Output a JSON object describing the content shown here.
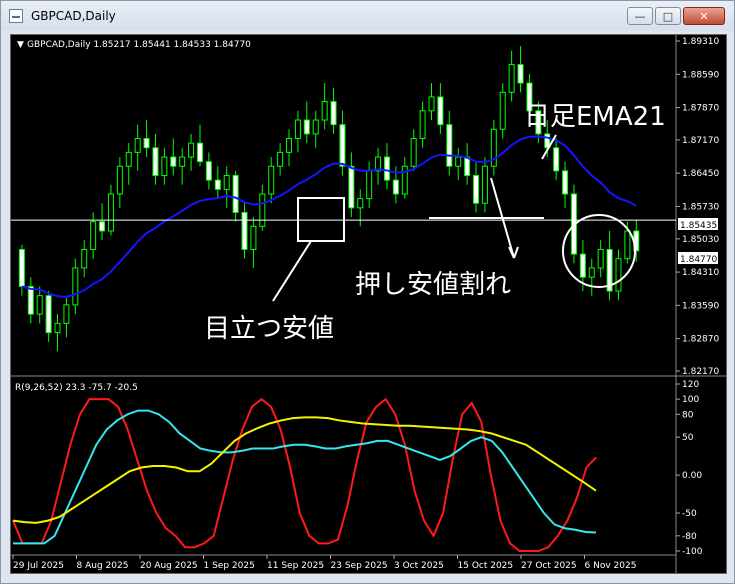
{
  "window": {
    "title": "GBPCAD,Daily"
  },
  "chart_header": "GBPCAD,Daily  1.85217 1.85441 1.84533 1.84770",
  "indicator_header": "R(9,26,52) 23.3 -75.7 -20.5",
  "annotations": {
    "ema_label": "日足EMA21",
    "notable_low": "目立つ安値",
    "break_label": "押し安値割れ"
  },
  "colors": {
    "bull": "#00ff00",
    "ema": "#1515ff",
    "r1": "#ff1a1a",
    "r2": "#35e6f0",
    "r3": "#f4f400",
    "annot": "#ffffff"
  },
  "chart_data": [
    {
      "type": "candlestick",
      "symbol": "GBPCAD",
      "timeframe": "Daily",
      "ohlc_last": [
        1.85217,
        1.85441,
        1.84533,
        1.8477
      ],
      "y_ticks": [
        "1.89310",
        "1.88590",
        "1.87870",
        "1.87170",
        "1.86450",
        "1.85730",
        "1.85030",
        "1.84310",
        "1.83590",
        "1.82870",
        "1.82170"
      ],
      "price_tags": [
        "1.85435",
        "1.84770"
      ],
      "horizontal_line": 1.85435,
      "ylim": [
        1.8217,
        1.8931
      ],
      "x_ticks": [
        "29 Jul 2025",
        "8 Aug 2025",
        "20 Aug 2025",
        "1 Sep 2025",
        "11 Sep 2025",
        "23 Sep 2025",
        "3 Oct 2025",
        "15 Oct 2025",
        "27 Oct 2025",
        "6 Nov 2025"
      ],
      "candles": [
        [
          1.848,
          1.849,
          1.838,
          1.84
        ],
        [
          1.84,
          1.842,
          1.832,
          1.834
        ],
        [
          1.834,
          1.84,
          1.832,
          1.838
        ],
        [
          1.838,
          1.839,
          1.828,
          1.83
        ],
        [
          1.83,
          1.834,
          1.826,
          1.832
        ],
        [
          1.832,
          1.838,
          1.829,
          1.836
        ],
        [
          1.836,
          1.846,
          1.834,
          1.844
        ],
        [
          1.844,
          1.85,
          1.842,
          1.848
        ],
        [
          1.848,
          1.856,
          1.846,
          1.854
        ],
        [
          1.854,
          1.858,
          1.85,
          1.852
        ],
        [
          1.852,
          1.862,
          1.851,
          1.86
        ],
        [
          1.86,
          1.868,
          1.857,
          1.866
        ],
        [
          1.866,
          1.871,
          1.862,
          1.869
        ],
        [
          1.869,
          1.875,
          1.865,
          1.872
        ],
        [
          1.872,
          1.876,
          1.868,
          1.87
        ],
        [
          1.87,
          1.873,
          1.862,
          1.864
        ],
        [
          1.864,
          1.87,
          1.862,
          1.868
        ],
        [
          1.868,
          1.872,
          1.864,
          1.866
        ],
        [
          1.866,
          1.87,
          1.862,
          1.868
        ],
        [
          1.868,
          1.873,
          1.865,
          1.871
        ],
        [
          1.871,
          1.875,
          1.866,
          1.867
        ],
        [
          1.867,
          1.869,
          1.861,
          1.863
        ],
        [
          1.863,
          1.866,
          1.859,
          1.861
        ],
        [
          1.861,
          1.866,
          1.857,
          1.864
        ],
        [
          1.864,
          1.865,
          1.854,
          1.856
        ],
        [
          1.856,
          1.858,
          1.846,
          1.848
        ],
        [
          1.848,
          1.855,
          1.844,
          1.853
        ],
        [
          1.853,
          1.862,
          1.852,
          1.86
        ],
        [
          1.86,
          1.868,
          1.858,
          1.866
        ],
        [
          1.866,
          1.871,
          1.864,
          1.869
        ],
        [
          1.869,
          1.874,
          1.866,
          1.872
        ],
        [
          1.872,
          1.878,
          1.869,
          1.876
        ],
        [
          1.876,
          1.88,
          1.871,
          1.873
        ],
        [
          1.873,
          1.878,
          1.87,
          1.876
        ],
        [
          1.876,
          1.884,
          1.874,
          1.88
        ],
        [
          1.88,
          1.883,
          1.873,
          1.875
        ],
        [
          1.875,
          1.878,
          1.864,
          1.866
        ],
        [
          1.866,
          1.869,
          1.855,
          1.857
        ],
        [
          1.857,
          1.861,
          1.853,
          1.859
        ],
        [
          1.859,
          1.867,
          1.857,
          1.865
        ],
        [
          1.865,
          1.87,
          1.862,
          1.868
        ],
        [
          1.868,
          1.871,
          1.861,
          1.863
        ],
        [
          1.863,
          1.866,
          1.858,
          1.86
        ],
        [
          1.86,
          1.868,
          1.859,
          1.866
        ],
        [
          1.866,
          1.874,
          1.865,
          1.872
        ],
        [
          1.872,
          1.88,
          1.87,
          1.878
        ],
        [
          1.878,
          1.884,
          1.876,
          1.881
        ],
        [
          1.881,
          1.884,
          1.873,
          1.875
        ],
        [
          1.875,
          1.878,
          1.864,
          1.866
        ],
        [
          1.866,
          1.87,
          1.863,
          1.868
        ],
        [
          1.868,
          1.871,
          1.862,
          1.864
        ],
        [
          1.864,
          1.867,
          1.856,
          1.858
        ],
        [
          1.858,
          1.868,
          1.856,
          1.866
        ],
        [
          1.866,
          1.876,
          1.864,
          1.874
        ],
        [
          1.874,
          1.884,
          1.872,
          1.882
        ],
        [
          1.882,
          1.891,
          1.88,
          1.888
        ],
        [
          1.888,
          1.892,
          1.882,
          1.884
        ],
        [
          1.884,
          1.886,
          1.876,
          1.878
        ],
        [
          1.878,
          1.88,
          1.871,
          1.873
        ],
        [
          1.873,
          1.876,
          1.868,
          1.87
        ],
        [
          1.87,
          1.872,
          1.863,
          1.865
        ],
        [
          1.865,
          1.867,
          1.857,
          1.86
        ],
        [
          1.86,
          1.862,
          1.845,
          1.847
        ],
        [
          1.847,
          1.85,
          1.839,
          1.842
        ],
        [
          1.842,
          1.846,
          1.838,
          1.844
        ],
        [
          1.844,
          1.85,
          1.842,
          1.848
        ],
        [
          1.848,
          1.852,
          1.837,
          1.839
        ],
        [
          1.839,
          1.848,
          1.837,
          1.846
        ],
        [
          1.846,
          1.854,
          1.845,
          1.852
        ],
        [
          1.852,
          1.8544,
          1.8453,
          1.8477
        ]
      ]
    },
    {
      "type": "line",
      "title": "R(9,26,52) 23.3 -75.7 -20.5",
      "ylim": [
        -100,
        120
      ],
      "y_ticks": [
        "120",
        "100",
        "80",
        "50",
        "0.00",
        "-50",
        "-80",
        "-100"
      ],
      "series": [
        {
          "values": [
            -60,
            -90,
            -90,
            -90,
            -60,
            -10,
            40,
            80,
            100,
            100,
            100,
            90,
            60,
            20,
            -20,
            -50,
            -70,
            -80,
            -95,
            -95,
            -90,
            -80,
            -30,
            20,
            60,
            90,
            100,
            90,
            60,
            10,
            -50,
            -80,
            -90,
            -90,
            -85,
            -40,
            20,
            70,
            90,
            100,
            80,
            40,
            -20,
            -60,
            -80,
            -50,
            20,
            80,
            95,
            70,
            0,
            -60,
            -90,
            -100,
            -100,
            -100,
            -95,
            -80,
            -60,
            -30,
            10,
            23.3
          ]
        },
        {
          "values": [
            -90,
            -90,
            -90,
            -90,
            -80,
            -50,
            -20,
            10,
            40,
            60,
            72,
            80,
            85,
            85,
            80,
            70,
            55,
            45,
            35,
            32,
            30,
            30,
            32,
            35,
            35,
            35,
            38,
            40,
            40,
            38,
            35,
            35,
            38,
            40,
            42,
            45,
            45,
            40,
            35,
            30,
            25,
            20,
            25,
            35,
            45,
            50,
            45,
            30,
            10,
            -10,
            -30,
            -50,
            -65,
            -70,
            -72,
            -75,
            -75.7
          ]
        },
        {
          "values": [
            -60,
            -62,
            -63,
            -60,
            -55,
            -45,
            -35,
            -25,
            -15,
            -5,
            5,
            10,
            12,
            12,
            10,
            5,
            5,
            15,
            30,
            45,
            55,
            62,
            68,
            72,
            75,
            76,
            76,
            75,
            72,
            70,
            68,
            67,
            66,
            65,
            65,
            64,
            63,
            62,
            61,
            60,
            58,
            55,
            50,
            45,
            40,
            30,
            20,
            10,
            0,
            -10,
            -20.5
          ]
        }
      ]
    }
  ]
}
